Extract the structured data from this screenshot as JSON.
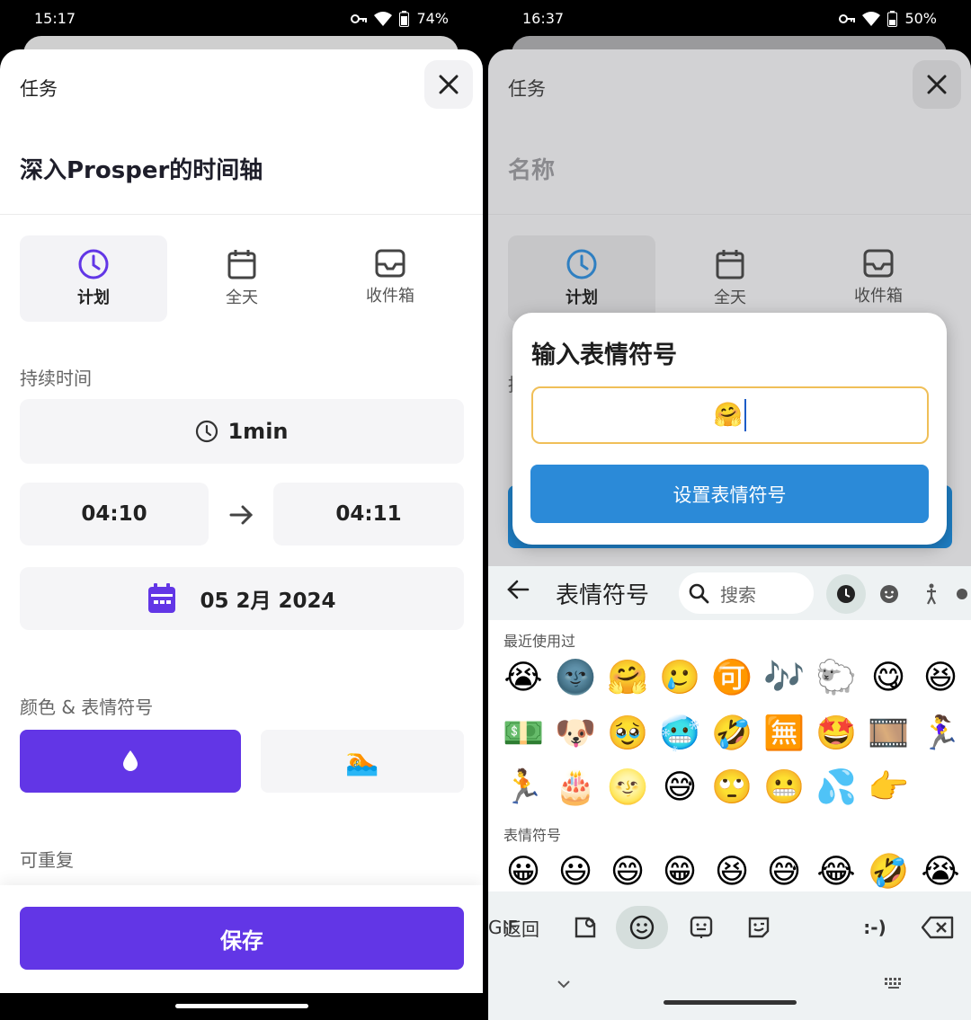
{
  "left": {
    "status": {
      "time": "15:17",
      "battery": "74%"
    },
    "header": {
      "title": "任务",
      "close_icon": "close-icon"
    },
    "task_name": "深入Prosper的时间轴",
    "tabs": [
      {
        "label": "计划",
        "icon": "clock-icon",
        "active": true
      },
      {
        "label": "全天",
        "icon": "calendar-icon",
        "active": false
      },
      {
        "label": "收件箱",
        "icon": "inbox-icon",
        "active": false
      }
    ],
    "duration": {
      "label": "持续时间",
      "value": "1min"
    },
    "times": {
      "start": "04:10",
      "end": "04:11"
    },
    "date": "05 2月 2024",
    "color_emoji": {
      "label": "颜色 & 表情符号",
      "color": "#6236e6",
      "emoji": "🏊"
    },
    "repeat_label": "可重复",
    "save_label": "保存"
  },
  "right": {
    "status": {
      "time": "16:37",
      "battery": "50%"
    },
    "header": {
      "title": "任务"
    },
    "name_placeholder": "名称",
    "tabs": [
      {
        "label": "计划"
      },
      {
        "label": "全天"
      },
      {
        "label": "收件箱"
      }
    ],
    "partial_label": "持",
    "dialog": {
      "title": "输入表情符号",
      "value": "🤗",
      "button": "设置表情符号"
    },
    "keyboard": {
      "title": "表情符号",
      "search_placeholder": "搜索",
      "recent_label": "最近使用过",
      "recent_rows": [
        [
          "😭",
          "🌚",
          "🤗",
          "🥲",
          "🉑",
          "🎶",
          "🐑",
          "😋",
          "😆"
        ],
        [
          "💵",
          "🐶",
          "🥹",
          "🥶",
          "🤣",
          "🈚",
          "🤩",
          "🎞️",
          "🏃‍♀️"
        ],
        [
          "🏃",
          "🎂",
          "🌝",
          "😅",
          "🙄",
          "😬",
          "💦",
          "👉"
        ]
      ],
      "emoji_label": "表情符号",
      "emoji_row": [
        "😀",
        "😃",
        "😄",
        "😁",
        "😆",
        "😅",
        "😂",
        "🤣",
        "😭"
      ],
      "bottom": {
        "back": "返回",
        "gif": "GIF",
        "emoticon": ":-)"
      }
    }
  }
}
